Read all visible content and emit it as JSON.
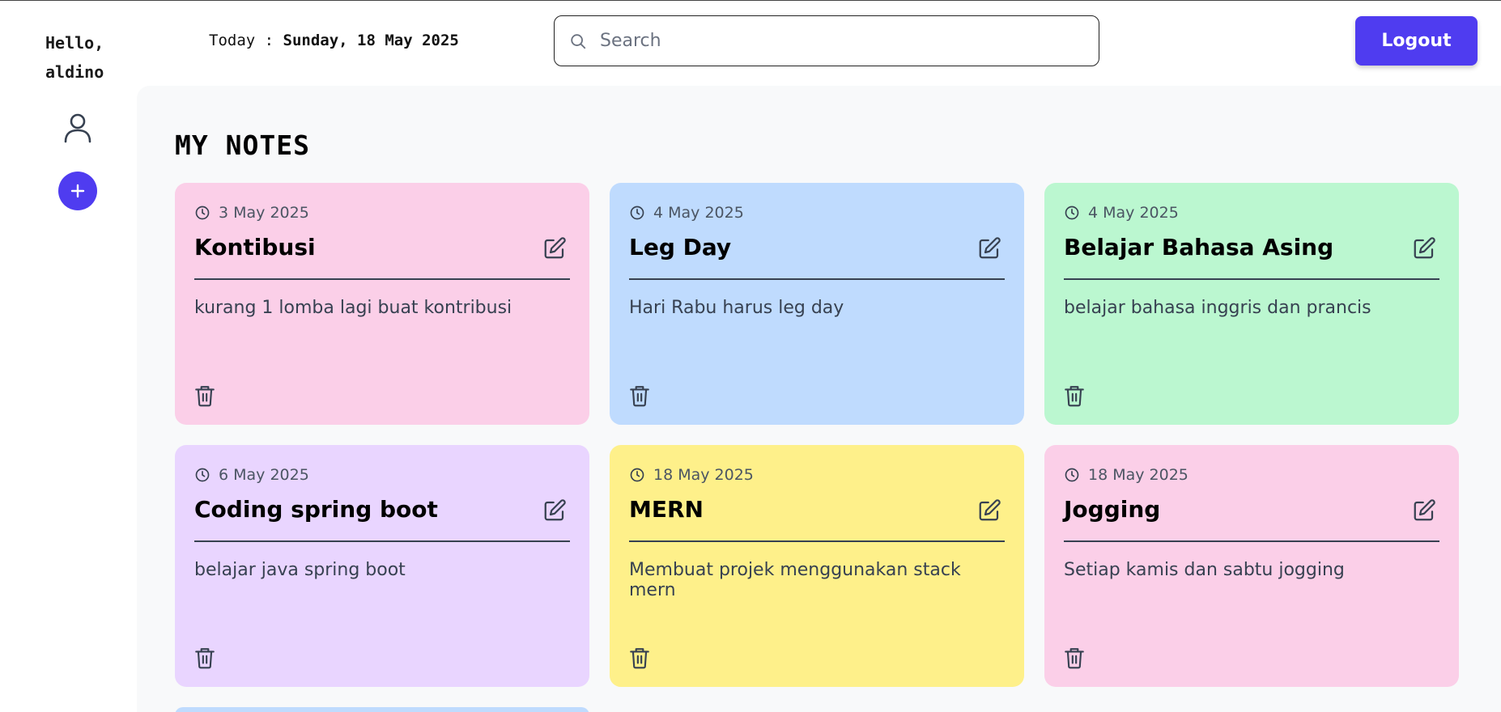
{
  "header": {
    "greeting": "Hello,",
    "username": "aldino",
    "today_label": "Today :",
    "today_value": "Sunday, 18 May 2025",
    "search_placeholder": "Search",
    "logout_label": "Logout"
  },
  "sidebar": {
    "profile_icon": "user-icon",
    "add_icon": "plus-icon"
  },
  "main": {
    "title": "MY NOTES"
  },
  "notes": [
    {
      "date": "3 May 2025",
      "title": "Kontibusi",
      "body": "kurang 1 lomba lagi buat kontribusi",
      "color": "#fbcfe8"
    },
    {
      "date": "4 May 2025",
      "title": "Leg Day",
      "body": "Hari Rabu harus leg day",
      "color": "#bfdbfe"
    },
    {
      "date": "4 May 2025",
      "title": "Belajar Bahasa Asing",
      "body": "belajar bahasa inggris dan prancis",
      "color": "#bbf7d0"
    },
    {
      "date": "6 May 2025",
      "title": "Coding spring boot",
      "body": "belajar java spring boot",
      "color": "#e9d5ff"
    },
    {
      "date": "18 May 2025",
      "title": "MERN",
      "body": "Membuat projek menggunakan stack mern",
      "color": "#fef08a"
    },
    {
      "date": "18 May 2025",
      "title": "Jogging",
      "body": "Setiap kamis dan sabtu jogging",
      "color": "#fbcfe8"
    }
  ],
  "partial_note_color": "#bfdbfe",
  "colors": {
    "accent": "#4f3cf0",
    "main_background": "#f8f9fa"
  }
}
